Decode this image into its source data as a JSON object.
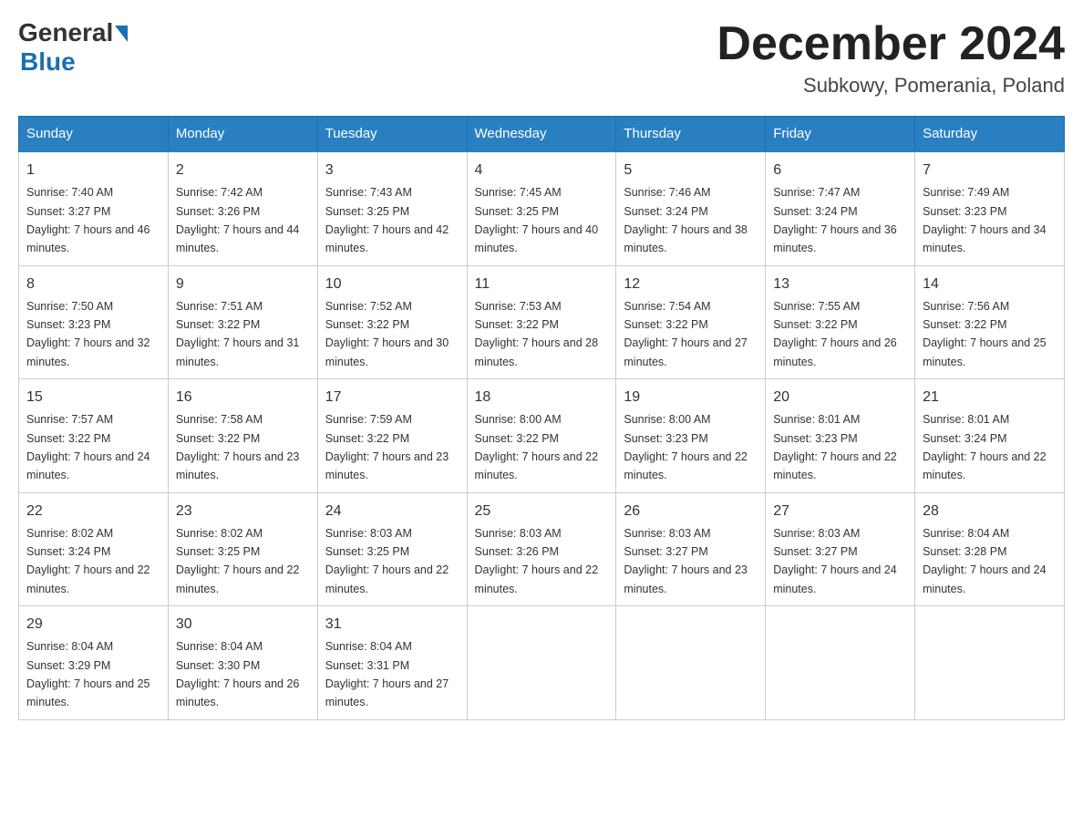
{
  "logo": {
    "general": "General",
    "blue": "Blue",
    "underline": "Blue"
  },
  "header": {
    "month_year": "December 2024",
    "location": "Subkowy, Pomerania, Poland"
  },
  "weekdays": [
    "Sunday",
    "Monday",
    "Tuesday",
    "Wednesday",
    "Thursday",
    "Friday",
    "Saturday"
  ],
  "weeks": [
    [
      {
        "day": "1",
        "sunrise": "7:40 AM",
        "sunset": "3:27 PM",
        "daylight": "7 hours and 46 minutes."
      },
      {
        "day": "2",
        "sunrise": "7:42 AM",
        "sunset": "3:26 PM",
        "daylight": "7 hours and 44 minutes."
      },
      {
        "day": "3",
        "sunrise": "7:43 AM",
        "sunset": "3:25 PM",
        "daylight": "7 hours and 42 minutes."
      },
      {
        "day": "4",
        "sunrise": "7:45 AM",
        "sunset": "3:25 PM",
        "daylight": "7 hours and 40 minutes."
      },
      {
        "day": "5",
        "sunrise": "7:46 AM",
        "sunset": "3:24 PM",
        "daylight": "7 hours and 38 minutes."
      },
      {
        "day": "6",
        "sunrise": "7:47 AM",
        "sunset": "3:24 PM",
        "daylight": "7 hours and 36 minutes."
      },
      {
        "day": "7",
        "sunrise": "7:49 AM",
        "sunset": "3:23 PM",
        "daylight": "7 hours and 34 minutes."
      }
    ],
    [
      {
        "day": "8",
        "sunrise": "7:50 AM",
        "sunset": "3:23 PM",
        "daylight": "7 hours and 32 minutes."
      },
      {
        "day": "9",
        "sunrise": "7:51 AM",
        "sunset": "3:22 PM",
        "daylight": "7 hours and 31 minutes."
      },
      {
        "day": "10",
        "sunrise": "7:52 AM",
        "sunset": "3:22 PM",
        "daylight": "7 hours and 30 minutes."
      },
      {
        "day": "11",
        "sunrise": "7:53 AM",
        "sunset": "3:22 PM",
        "daylight": "7 hours and 28 minutes."
      },
      {
        "day": "12",
        "sunrise": "7:54 AM",
        "sunset": "3:22 PM",
        "daylight": "7 hours and 27 minutes."
      },
      {
        "day": "13",
        "sunrise": "7:55 AM",
        "sunset": "3:22 PM",
        "daylight": "7 hours and 26 minutes."
      },
      {
        "day": "14",
        "sunrise": "7:56 AM",
        "sunset": "3:22 PM",
        "daylight": "7 hours and 25 minutes."
      }
    ],
    [
      {
        "day": "15",
        "sunrise": "7:57 AM",
        "sunset": "3:22 PM",
        "daylight": "7 hours and 24 minutes."
      },
      {
        "day": "16",
        "sunrise": "7:58 AM",
        "sunset": "3:22 PM",
        "daylight": "7 hours and 23 minutes."
      },
      {
        "day": "17",
        "sunrise": "7:59 AM",
        "sunset": "3:22 PM",
        "daylight": "7 hours and 23 minutes."
      },
      {
        "day": "18",
        "sunrise": "8:00 AM",
        "sunset": "3:22 PM",
        "daylight": "7 hours and 22 minutes."
      },
      {
        "day": "19",
        "sunrise": "8:00 AM",
        "sunset": "3:23 PM",
        "daylight": "7 hours and 22 minutes."
      },
      {
        "day": "20",
        "sunrise": "8:01 AM",
        "sunset": "3:23 PM",
        "daylight": "7 hours and 22 minutes."
      },
      {
        "day": "21",
        "sunrise": "8:01 AM",
        "sunset": "3:24 PM",
        "daylight": "7 hours and 22 minutes."
      }
    ],
    [
      {
        "day": "22",
        "sunrise": "8:02 AM",
        "sunset": "3:24 PM",
        "daylight": "7 hours and 22 minutes."
      },
      {
        "day": "23",
        "sunrise": "8:02 AM",
        "sunset": "3:25 PM",
        "daylight": "7 hours and 22 minutes."
      },
      {
        "day": "24",
        "sunrise": "8:03 AM",
        "sunset": "3:25 PM",
        "daylight": "7 hours and 22 minutes."
      },
      {
        "day": "25",
        "sunrise": "8:03 AM",
        "sunset": "3:26 PM",
        "daylight": "7 hours and 22 minutes."
      },
      {
        "day": "26",
        "sunrise": "8:03 AM",
        "sunset": "3:27 PM",
        "daylight": "7 hours and 23 minutes."
      },
      {
        "day": "27",
        "sunrise": "8:03 AM",
        "sunset": "3:27 PM",
        "daylight": "7 hours and 24 minutes."
      },
      {
        "day": "28",
        "sunrise": "8:04 AM",
        "sunset": "3:28 PM",
        "daylight": "7 hours and 24 minutes."
      }
    ],
    [
      {
        "day": "29",
        "sunrise": "8:04 AM",
        "sunset": "3:29 PM",
        "daylight": "7 hours and 25 minutes."
      },
      {
        "day": "30",
        "sunrise": "8:04 AM",
        "sunset": "3:30 PM",
        "daylight": "7 hours and 26 minutes."
      },
      {
        "day": "31",
        "sunrise": "8:04 AM",
        "sunset": "3:31 PM",
        "daylight": "7 hours and 27 minutes."
      },
      null,
      null,
      null,
      null
    ]
  ]
}
